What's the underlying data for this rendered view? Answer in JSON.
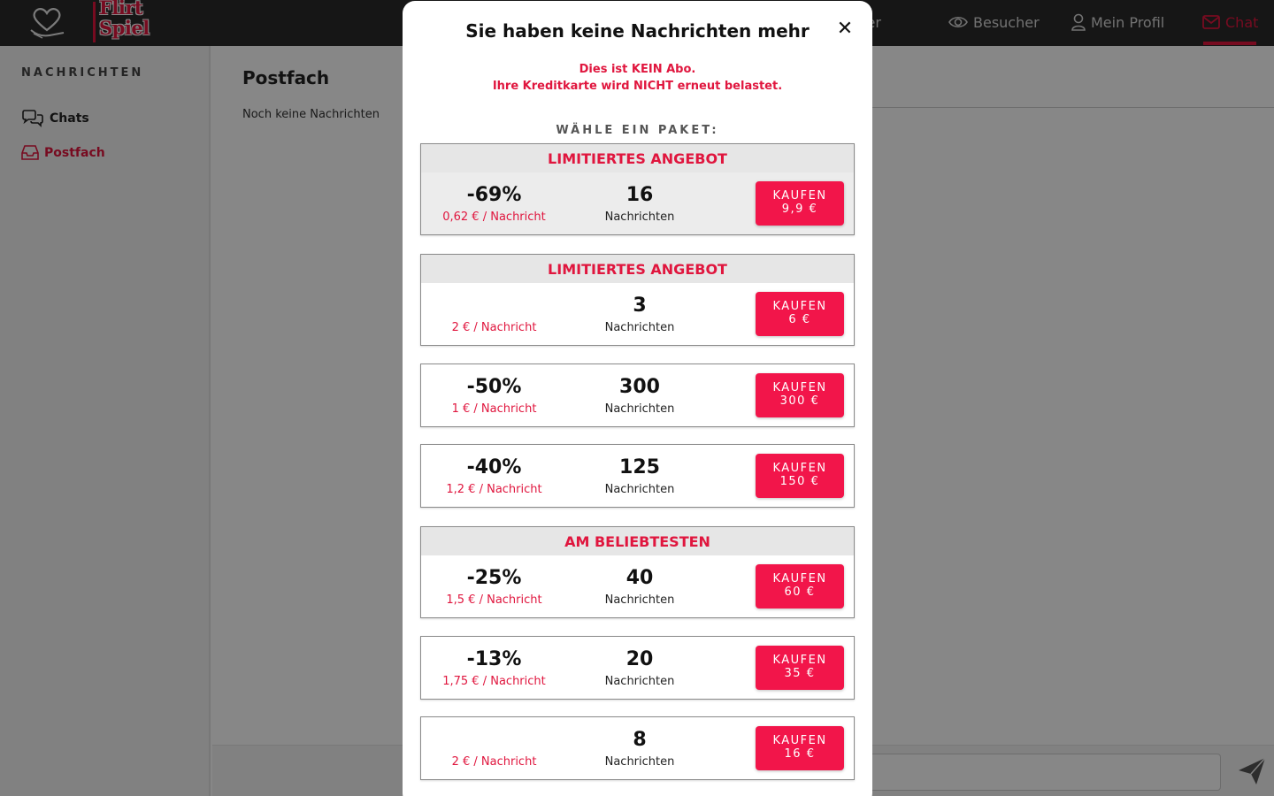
{
  "nav": {
    "logo_line1": "Flirt",
    "logo_line2": "Spiel",
    "items": [
      {
        "label": "Treffer"
      },
      {
        "label": "Besucher"
      },
      {
        "label": "Mein Profil"
      },
      {
        "label": "Chat"
      }
    ],
    "active_color": "#e0163e"
  },
  "sidebar": {
    "title": "NACHRICHTEN",
    "items": [
      {
        "label": "Chats"
      },
      {
        "label": "Postfach"
      }
    ]
  },
  "main": {
    "title": "Postfach",
    "empty_text": "Noch keine Nachrichten"
  },
  "modal": {
    "title": "Sie haben keine Nachrichten mehr",
    "close": "✕",
    "notice_line1": "Dies ist KEIN Abo.",
    "notice_line2": "Ihre Kreditkarte wird NICHT erneut belastet.",
    "choose_label": "WÄHLE EIN PAKET:",
    "packages": [
      {
        "badge": "LIMITIERTES ANGEBOT",
        "discount": "-69%",
        "unit_price": "0,62 € / Nachricht",
        "count": "16",
        "count_label": "Nachrichten",
        "buy_label": "KAUFEN",
        "price": "9,9 €"
      },
      {
        "badge": "LIMITIERTES ANGEBOT",
        "discount": "",
        "unit_price": "2 € / Nachricht",
        "count": "3",
        "count_label": "Nachrichten",
        "buy_label": "KAUFEN",
        "price": "6 €"
      },
      {
        "badge": "",
        "discount": "-50%",
        "unit_price": "1 € / Nachricht",
        "count": "300",
        "count_label": "Nachrichten",
        "buy_label": "KAUFEN",
        "price": "300 €"
      },
      {
        "badge": "",
        "discount": "-40%",
        "unit_price": "1,2 € / Nachricht",
        "count": "125",
        "count_label": "Nachrichten",
        "buy_label": "KAUFEN",
        "price": "150 €"
      },
      {
        "badge": "AM BELIEBTESTEN",
        "discount": "-25%",
        "unit_price": "1,5 € / Nachricht",
        "count": "40",
        "count_label": "Nachrichten",
        "buy_label": "KAUFEN",
        "price": "60 €"
      },
      {
        "badge": "",
        "discount": "-13%",
        "unit_price": "1,75 € / Nachricht",
        "count": "20",
        "count_label": "Nachrichten",
        "buy_label": "KAUFEN",
        "price": "35 €"
      },
      {
        "badge": "",
        "discount": "",
        "unit_price": "2 € / Nachricht",
        "count": "8",
        "count_label": "Nachrichten",
        "buy_label": "KAUFEN",
        "price": "16 €"
      }
    ]
  }
}
